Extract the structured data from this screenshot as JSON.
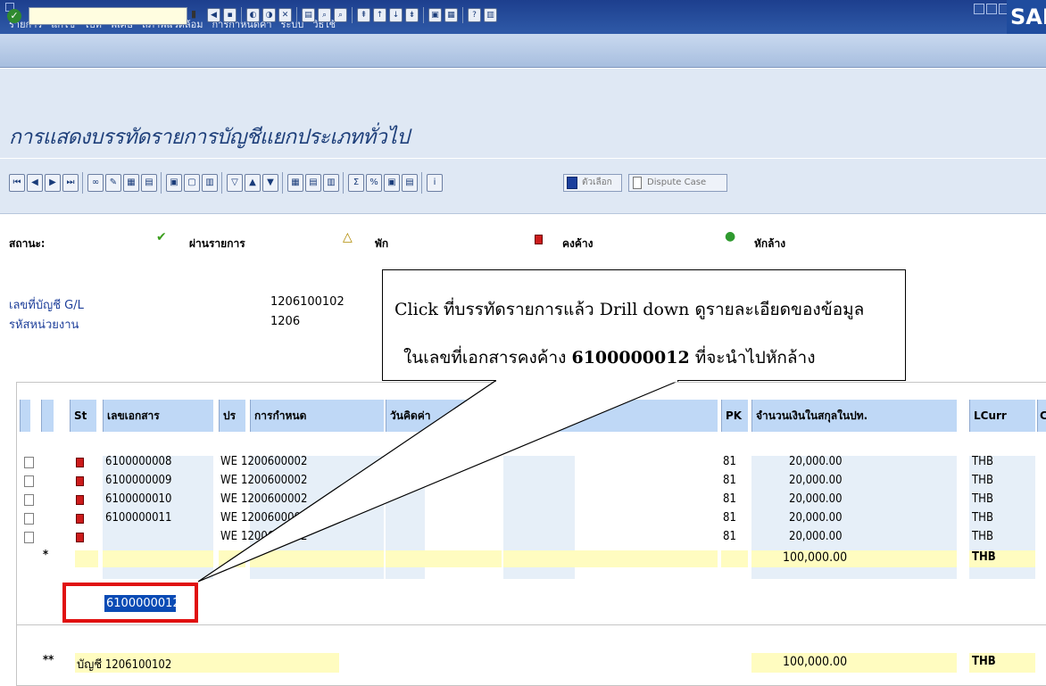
{
  "menu": {
    "items": [
      "รายการ",
      "แก้ไข",
      "ไปที่",
      "พิเศษ",
      "สภาพแวดล้อม",
      "การกำหนดค่า",
      "ระบบ",
      "วิธีใช้"
    ],
    "logo": "SAP"
  },
  "title": "การแสดงบรรทัดรายการบัญชีแยกประเภททั่วไป",
  "toolbar": {
    "selection_label": "ตัวเลือก",
    "dispute_label": "Dispute Case"
  },
  "legend": {
    "status_label": "สถานะ:",
    "cleared": "ผ่านรายการ",
    "parked": "พัก",
    "open": "คงค้าง",
    "cleared_off": "หักล้าง"
  },
  "info": {
    "account_label": "เลขที่บัญชี G/L",
    "account_value": "1206100102",
    "company_label": "รหัสหน่วยงาน",
    "company_value": "1206"
  },
  "table": {
    "headers": {
      "st": "St",
      "doc": "เลขเอกสาร",
      "type": "ปร",
      "assignment": "การกำหนด",
      "date": "วันคิดค่า",
      "pk": "PK",
      "amount": "จำนวนเงินในสกุลในปท.",
      "lcurr": "LCurr",
      "extra": "Cl"
    },
    "rows": [
      {
        "doc": "6100000008",
        "type": "WE",
        "assignment": "1200600002",
        "pk": "81",
        "amount": "20,000.00",
        "curr": "THB"
      },
      {
        "doc": "6100000009",
        "type": "WE",
        "assignment": "1200600002",
        "pk": "81",
        "amount": "20,000.00",
        "curr": "THB"
      },
      {
        "doc": "6100000010",
        "type": "WE",
        "assignment": "1200600002",
        "pk": "81",
        "amount": "20,000.00",
        "curr": "THB"
      },
      {
        "doc": "6100000011",
        "type": "WE",
        "assignment": "1200600002",
        "pk": "81",
        "amount": "20,000.00",
        "curr": "THB"
      },
      {
        "doc": "6100000012",
        "type": "WE",
        "assignment": "1200600002",
        "pk": "81",
        "amount": "20,000.00",
        "curr": "THB"
      }
    ],
    "subtotal": {
      "marker": "*",
      "amount": "100,000.00",
      "curr": "THB"
    },
    "total": {
      "marker": "**",
      "label": "บัญชี 1206100102",
      "amount": "100,000.00",
      "curr": "THB"
    }
  },
  "callout": {
    "line1": "Click ที่บรรทัดรายการแล้ว Drill down ดูรายละเอียดของข้อมูล",
    "line2_pre": "ในเลขที่เอกสารคงค้าง ",
    "line2_bold": "6100000012",
    "line2_post": " ที่จะนำไปหักล้าง"
  },
  "colors": {
    "header_bg": "#bfd8f6",
    "open_status": "#cc1b1b",
    "highlight": "#e01010",
    "subtotal_bg": "#fffcc0"
  }
}
